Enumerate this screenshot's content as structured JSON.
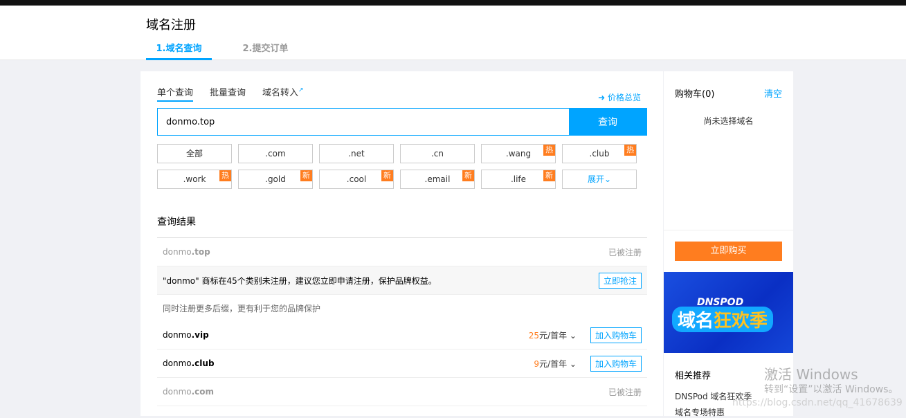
{
  "header": {
    "title": "域名注册",
    "steps": [
      "1.域名查询",
      "2.提交订单"
    ]
  },
  "query": {
    "tabs": [
      "单个查询",
      "批量查询",
      "域名转入"
    ],
    "price_link": "价格总览",
    "input_value": "donmo.top",
    "search_button": "查询"
  },
  "suffixes": [
    {
      "label": "全部",
      "badge": ""
    },
    {
      "label": ".com",
      "badge": ""
    },
    {
      "label": ".net",
      "badge": ""
    },
    {
      "label": ".cn",
      "badge": ""
    },
    {
      "label": ".wang",
      "badge": "热"
    },
    {
      "label": ".club",
      "badge": "热"
    },
    {
      "label": ".work",
      "badge": "热"
    },
    {
      "label": ".gold",
      "badge": "新"
    },
    {
      "label": ".cool",
      "badge": "新"
    },
    {
      "label": ".email",
      "badge": "新"
    },
    {
      "label": ".life",
      "badge": "新"
    },
    {
      "label": "展开",
      "badge": ""
    }
  ],
  "results": {
    "title": "查询结果",
    "main": {
      "name": "donmo",
      "tld": ".top",
      "status": "已被注册"
    },
    "trademark": {
      "text": "\"donmo\" 商标在45个类别未注册，建议您立即申请注册，保护品牌权益。",
      "button": "立即抢注"
    },
    "note": "同时注册更多后缀，更有利于您的品牌保护",
    "rows": [
      {
        "name": "donmo",
        "tld": ".vip",
        "price": "25",
        "unit": "元/首年",
        "button": "加入购物车"
      },
      {
        "name": "donmo",
        "tld": ".club",
        "price": "9",
        "unit": "元/首年",
        "button": "加入购物车"
      },
      {
        "name": "donmo",
        "tld": ".com",
        "status": "已被注册"
      }
    ]
  },
  "cart": {
    "title": "购物车(0)",
    "clear": "清空",
    "empty": "尚未选择域名",
    "buy": "立即购买"
  },
  "banner": {
    "line1": "DNSPOD",
    "line2a": "域名",
    "line2b": "狂欢季"
  },
  "related": {
    "title": "相关推荐",
    "items": [
      "DNSPod 域名狂欢季",
      "域名专场特惠"
    ]
  },
  "watermark": {
    "line1": "激活 Windows",
    "line2": "转到“设置”以激活 Windows。",
    "url": "https://blog.csdn.net/qq_41678639"
  },
  "colors": {
    "accent": "#00a4ff",
    "orange": "#ff7d1f"
  }
}
